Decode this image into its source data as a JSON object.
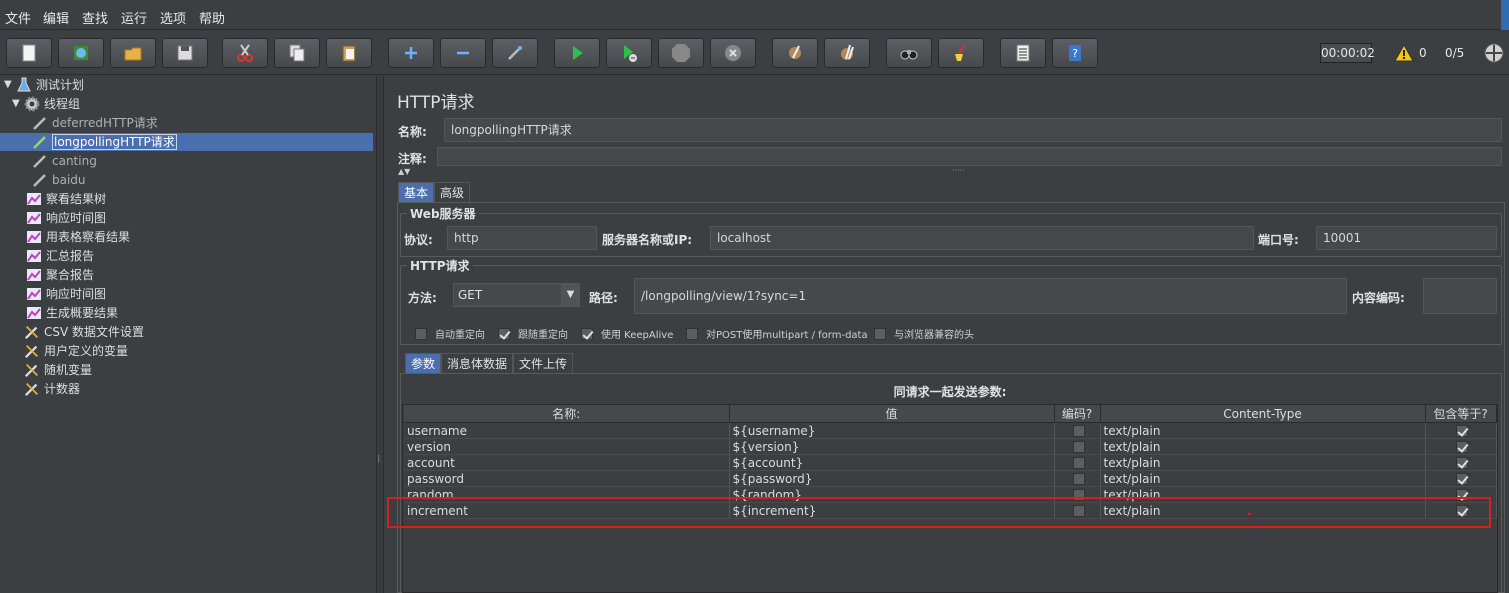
{
  "menu": [
    "文件",
    "编辑",
    "查找",
    "运行",
    "选项",
    "帮助"
  ],
  "toolbar": {
    "timer": "00:00:02",
    "warning_count": "0",
    "threads": "0/5",
    "buttons": [
      "new",
      "templates",
      "open",
      "save",
      "cut",
      "copy",
      "paste",
      "expand",
      "collapse",
      "toggle",
      "start",
      "start-no-pauses",
      "stop",
      "shutdown",
      "clear",
      "clear-all",
      "search",
      "reset-search",
      "function-helper",
      "help"
    ]
  },
  "tree": {
    "root": "测试计划",
    "thread_group": "线程组",
    "samplers": [
      "deferredHTTP请求",
      "longpollingHTTP请求",
      "canting",
      "baidu"
    ],
    "selected": "longpollingHTTP请求",
    "listeners": [
      "察看结果树",
      "响应时间图",
      "用表格察看结果",
      "汇总报告",
      "聚合报告",
      "响应时间图",
      "生成概要结果"
    ],
    "config": [
      "CSV 数据文件设置",
      "用户定义的变量",
      "随机变量",
      "计数器"
    ]
  },
  "panel": {
    "title": "HTTP请求",
    "name_label": "名称:",
    "name_value": "longpollingHTTP请求",
    "comment_label": "注释:",
    "comment_value": "",
    "tabs": [
      "基本",
      "高级"
    ],
    "web_server": {
      "title": "Web服务器",
      "protocol_label": "协议:",
      "protocol_value": "http",
      "server_label": "服务器名称或IP:",
      "server_value": "localhost",
      "port_label": "端口号:",
      "port_value": "10001"
    },
    "http_request": {
      "title": "HTTP请求",
      "method_label": "方法:",
      "method_value": "GET",
      "path_label": "路径:",
      "path_value": "/longpolling/view/1?sync=1",
      "encoding_label": "内容编码:",
      "encoding_value": ""
    },
    "options": [
      {
        "label": "自动重定向",
        "checked": false
      },
      {
        "label": "跟随重定向",
        "checked": true
      },
      {
        "label": "使用 KeepAlive",
        "checked": true
      },
      {
        "label": "对POST使用multipart / form-data",
        "checked": false
      },
      {
        "label": "与浏览器兼容的头",
        "checked": false
      }
    ],
    "param_tabs": [
      "参数",
      "消息体数据",
      "文件上传"
    ],
    "params_caption": "同请求一起发送参数:",
    "columns": [
      "名称:",
      "值",
      "编码?",
      "Content-Type",
      "包含等于?"
    ],
    "rows": [
      {
        "name": "username",
        "value": "${username}",
        "encode": false,
        "ctype": "text/plain",
        "equals": true
      },
      {
        "name": "version",
        "value": "${version}",
        "encode": false,
        "ctype": "text/plain",
        "equals": true
      },
      {
        "name": "account",
        "value": "${account}",
        "encode": false,
        "ctype": "text/plain",
        "equals": true
      },
      {
        "name": "password",
        "value": "${password}",
        "encode": false,
        "ctype": "text/plain",
        "equals": true
      },
      {
        "name": "random",
        "value": "${random}",
        "encode": false,
        "ctype": "text/plain",
        "equals": true
      },
      {
        "name": "increment",
        "value": "${increment}",
        "encode": false,
        "ctype": "text/plain",
        "equals": true
      }
    ],
    "highlight_color": "#d81e1e"
  }
}
